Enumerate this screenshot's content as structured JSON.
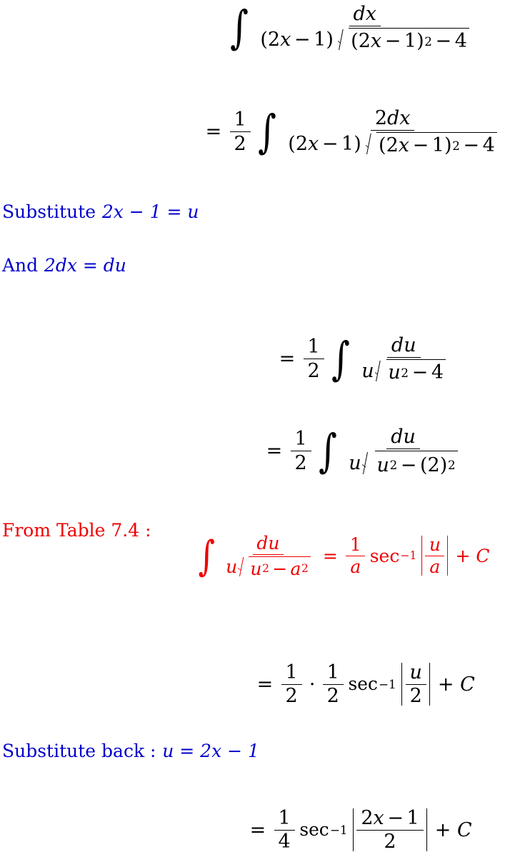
{
  "document": {
    "kind": "worked-calculus-solution",
    "colors": {
      "text_black": "#000000",
      "annotation_blue": "#0000CC",
      "reference_red": "#EE0000",
      "background": "#FFFFFF"
    }
  },
  "lines": [
    {
      "id": "line1",
      "role": "problem-integral",
      "color": "#000000",
      "latex": "\\int \\frac{dx}{(2x-1)\\sqrt{(2x-1)^2-4}}",
      "plain": "∫ dx / ((2x−1)√((2x−1)² − 4))",
      "parts": {
        "integral": "∫",
        "numerator": "dx",
        "denom_factor": "(2x − 1)",
        "radicand": "(2x − 1)² − 4"
      }
    },
    {
      "id": "line2",
      "role": "factored-out-constant",
      "color": "#000000",
      "latex": "= \\frac{1}{2}\\int \\frac{2dx}{(2x-1)\\sqrt{(2x-1)^2-4}}",
      "plain": "= 1/2 ∫ 2dx / ((2x−1)√((2x−1)² − 4))",
      "parts": {
        "equals": "=",
        "coefficient_num": "1",
        "coefficient_den": "2",
        "integral": "∫",
        "numerator": "2dx",
        "denom_factor": "(2x − 1)",
        "radicand": "(2x − 1)² − 4"
      }
    },
    {
      "id": "note1",
      "role": "substitution-note",
      "color": "#0000CC",
      "text": "Substitute",
      "math_plain": "2x − 1 = u"
    },
    {
      "id": "note2",
      "role": "differential-note",
      "color": "#0000CC",
      "text": "And",
      "math_plain": "2dx = du"
    },
    {
      "id": "line3",
      "role": "after-substitution",
      "color": "#000000",
      "latex": "= \\frac{1}{2}\\int \\frac{du}{u\\sqrt{u^2-4}}",
      "plain": "= 1/2 ∫ du / (u√(u² − 4))",
      "parts": {
        "equals": "=",
        "coefficient_num": "1",
        "coefficient_den": "2",
        "integral": "∫",
        "numerator": "du",
        "denom_factor": "u",
        "radicand": "u² − 4"
      }
    },
    {
      "id": "line4",
      "role": "rewrite-as-square",
      "color": "#000000",
      "latex": "= \\frac{1}{2}\\int \\frac{du}{u\\sqrt{u^2-(2)^2}}",
      "plain": "= 1/2 ∫ du / (u√(u² − (2)²))",
      "parts": {
        "equals": "=",
        "coefficient_num": "1",
        "coefficient_den": "2",
        "integral": "∫",
        "numerator": "du",
        "denom_factor": "u",
        "radicand": "u² − (2)²"
      }
    },
    {
      "id": "note3",
      "role": "table-reference-label",
      "color": "#EE0000",
      "text": "From Table 7.4 :"
    },
    {
      "id": "line5",
      "role": "table-formula",
      "color": "#EE0000",
      "latex": "\\int \\frac{du}{u\\sqrt{u^2-a^2}} = \\frac{1}{a}\\sec^{-1}\\left|\\frac{u}{a}\\right| + C",
      "plain": "∫ du / (u√(u² − a²)) = (1/a) sec⁻¹ |u/a| + C",
      "parts": {
        "integral": "∫",
        "numerator": "du",
        "denom_factor": "u",
        "radicand": "u² − a²",
        "equals": "=",
        "coefficient_num": "1",
        "coefficient_den": "a",
        "function": "sec",
        "function_exponent": "−1",
        "abs_num": "u",
        "abs_den": "a",
        "plus_c": "+ C"
      }
    },
    {
      "id": "line6",
      "role": "applied-formula",
      "color": "#000000",
      "latex": "= \\frac{1}{2}\\cdot\\frac{1}{2}\\sec^{-1}\\left|\\frac{u}{2}\\right| + C",
      "plain": "= 1/2 · 1/2 sec⁻¹ |u/2| + C",
      "parts": {
        "equals": "=",
        "first_num": "1",
        "first_den": "2",
        "dot": "·",
        "second_num": "1",
        "second_den": "2",
        "function": "sec",
        "function_exponent": "−1",
        "abs_num": "u",
        "abs_den": "2",
        "plus_c": "+ C"
      }
    },
    {
      "id": "note4",
      "role": "back-substitution-note",
      "color": "#0000CC",
      "text": "Substitute back :",
      "math_plain": "u = 2x − 1"
    },
    {
      "id": "line7",
      "role": "final-answer",
      "color": "#000000",
      "latex": "= \\frac{1}{4}\\sec^{-1}\\left|\\frac{2x-1}{2}\\right| + C",
      "plain": "= (1/4) sec⁻¹ |(2x−1)/2| + C",
      "parts": {
        "equals": "=",
        "coefficient_num": "1",
        "coefficient_den": "4",
        "function": "sec",
        "function_exponent": "−1",
        "abs_num": "2x − 1",
        "abs_den": "2",
        "plus_c": "+ C"
      }
    }
  ],
  "tokens": {
    "integral_sign": "∫",
    "equals": "=",
    "minus": "−",
    "plus": "+",
    "cdot": "·",
    "colon": ":",
    "sec": "sec",
    "inv_one": "−1",
    "two": "2",
    "four": "4",
    "one": "1",
    "a": "a",
    "u": "u",
    "x": "x",
    "C": "C",
    "d": "d",
    "dx": "dx",
    "du": "du",
    "two_dx": "2dx",
    "sup_two": "2",
    "paren_open": "(",
    "paren_close": ")",
    "substitute": "Substitute",
    "and": "And",
    "substitute_back": "Substitute back :",
    "from_table": "From Table 7.4 :",
    "sub_expr_1": "2x − 1 = u",
    "sub_expr_2": "2dx = du",
    "sub_expr_3": "u = 2x − 1",
    "expr_2x_minus_1": "2x − 1",
    "minus_four": "− 4",
    "plus_c": "+ C"
  }
}
